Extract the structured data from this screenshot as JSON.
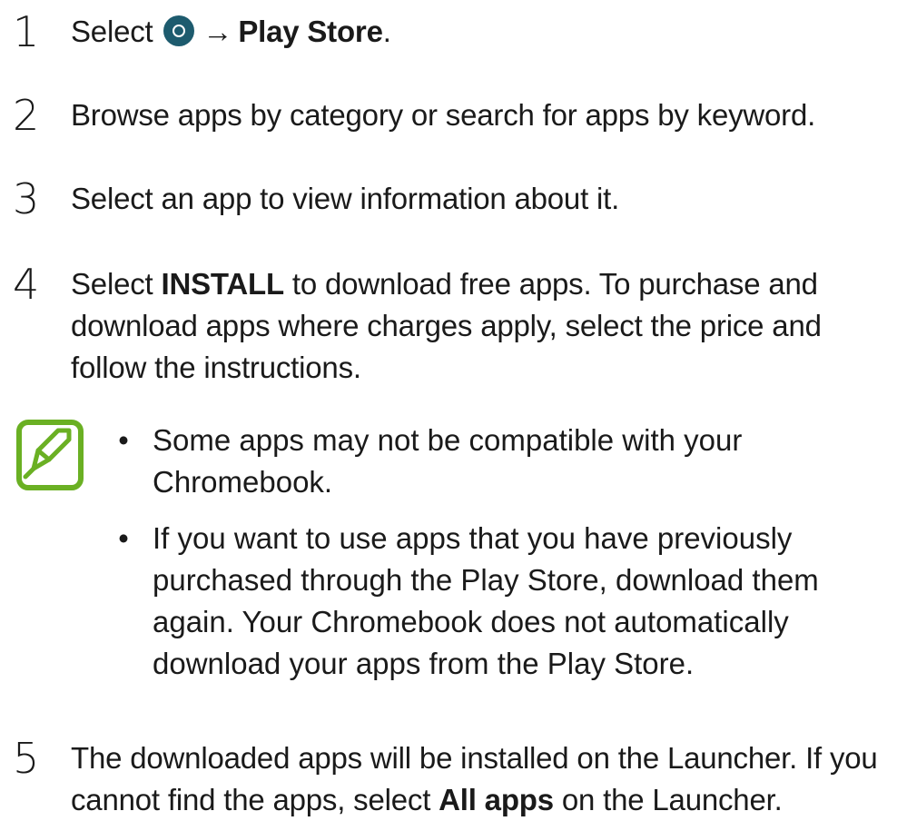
{
  "steps": [
    {
      "number": "1",
      "pre": "Select",
      "icon": "launcher-icon",
      "arrow": "→",
      "bold": "Play Store",
      "post": "."
    },
    {
      "number": "2",
      "text": "Browse apps by category or search for apps by keyword."
    },
    {
      "number": "3",
      "text": "Select an app to view information about it."
    },
    {
      "number": "4",
      "pre": "Select ",
      "bold": "INSTALL",
      "post_line1": " to download free apps. To purchase and",
      "line2": "download apps where charges apply, select the price and",
      "line3": "follow the instructions."
    },
    {
      "number": "5",
      "line1": "The downloaded apps will be installed on the Launcher. If you",
      "pre2": "cannot find the apps, select ",
      "bold": "All apps",
      "post2": " on the Launcher."
    }
  ],
  "note": {
    "icon": "note-pen-icon",
    "icon_color": "#6ab023",
    "bullet_char": "•",
    "bullets": [
      {
        "lines": [
          "Some apps may not be compatible with your",
          "Chromebook."
        ]
      },
      {
        "lines": [
          "If you want to use apps that you have previously",
          "purchased through the Play Store, download them",
          "again. Your Chromebook does not automatically",
          "download your apps from the Play Store."
        ]
      }
    ]
  }
}
